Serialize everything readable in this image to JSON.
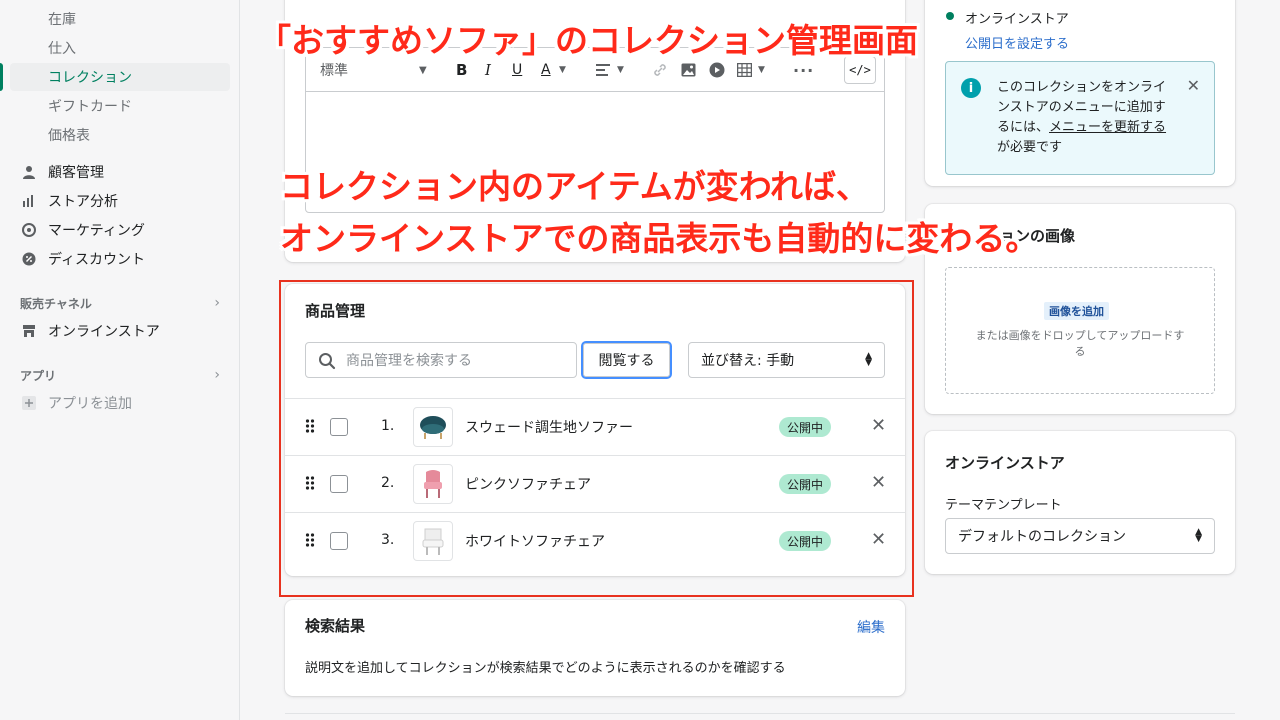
{
  "sidebar": {
    "sub_items": [
      {
        "label": "在庫"
      },
      {
        "label": "仕入"
      },
      {
        "label": "コレクション"
      },
      {
        "label": "ギフトカード"
      },
      {
        "label": "価格表"
      }
    ],
    "main_items": [
      {
        "label": "顧客管理",
        "icon": "person-icon"
      },
      {
        "label": "ストア分析",
        "icon": "bar-chart-icon"
      },
      {
        "label": "マーケティング",
        "icon": "target-icon"
      },
      {
        "label": "ディスカウント",
        "icon": "discount-icon"
      }
    ],
    "sales_channels_title": "販売チャネル",
    "online_store": "オンラインストア",
    "apps_title": "アプリ",
    "add_app": "アプリを追加"
  },
  "editor": {
    "format_select": "標準"
  },
  "overlay": {
    "title": "「おすすめソファ」のコレクション管理画面",
    "line1": "コレクション内のアイテムが変われば、",
    "line2": "オンラインストアでの商品表示も自動的に変わる。"
  },
  "products": {
    "title": "商品管理",
    "search_placeholder": "商品管理を検索する",
    "browse_label": "閲覧する",
    "sort_label": "並び替え: 手動",
    "items": [
      {
        "num": "1.",
        "name": "スウェード調生地ソファー",
        "status": "公開中"
      },
      {
        "num": "2.",
        "name": "ピンクソファチェア",
        "status": "公開中"
      },
      {
        "num": "3.",
        "name": "ホワイトソファチェア",
        "status": "公開中"
      }
    ]
  },
  "seo": {
    "title": "検索結果",
    "edit": "編集",
    "description": "説明文を追加してコレクションが検索結果でどのように表示されるのかを確認する"
  },
  "availability": {
    "channel": "オンラインストア",
    "set_date": "公開日を設定する",
    "banner_text_1": "このコレクションをオンラインストアのメニューに追加するには、",
    "banner_link": "メニューを更新する",
    "banner_text_2": "が必要です"
  },
  "image_card": {
    "title": "ョンの画像",
    "add_button": "画像を追加",
    "drop_text": "または画像をドロップしてアップロードする"
  },
  "online_store_card": {
    "title": "オンラインストア",
    "template_label": "テーマテンプレート",
    "template_value": "デフォルトのコレクション"
  },
  "colors": {
    "accent": "#008060",
    "badge": "#aee9d1",
    "link": "#2c6ecb",
    "annotation": "#ff2a1a"
  }
}
